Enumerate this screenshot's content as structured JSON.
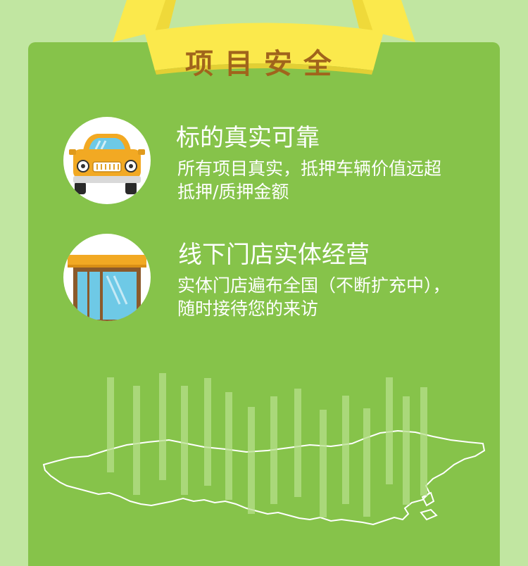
{
  "section": {
    "title": "项目安全"
  },
  "features": [
    {
      "icon": "car-icon",
      "title": "标的真实可靠",
      "desc_line1": "所有项目真实，抵押车辆价值远超",
      "desc_line2": "抵押/质押金额"
    },
    {
      "icon": "storefront-icon",
      "title": "线下门店实体经营",
      "desc_line1": "实体门店遍布全国（不断扩充中），",
      "desc_line2": "随时接待您的来访"
    }
  ],
  "decoration": {
    "map": "china-map-outline",
    "bars": "vertical-light-bars"
  },
  "colors": {
    "page_bg": "#c1e6a1",
    "panel_bg": "#86c34a",
    "ribbon": "#fbe94c",
    "ribbon_text": "#a0641c",
    "text": "#ffffff"
  }
}
